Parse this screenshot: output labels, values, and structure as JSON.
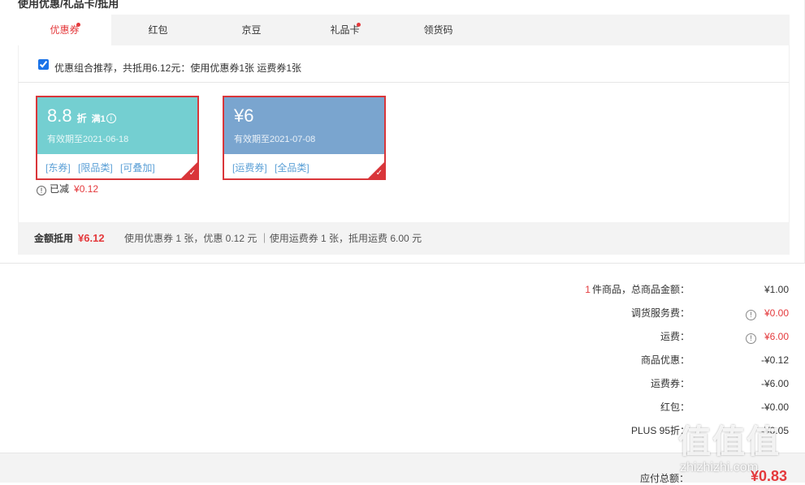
{
  "section_title": "使用优惠/礼品卡/抵用",
  "tabs": [
    {
      "label": "优惠券",
      "dot": true
    },
    {
      "label": "红包",
      "dot": false
    },
    {
      "label": "京豆",
      "dot": false
    },
    {
      "label": "礼品卡",
      "dot": true
    },
    {
      "label": "领货码",
      "dot": false
    }
  ],
  "recommend": {
    "checked": true,
    "text": "优惠组合推荐，共抵用6.12元：使用优惠券1张 运费券1张"
  },
  "coupons": [
    {
      "value": "8.8",
      "unit": "折",
      "condition": "满1",
      "expiry": "有效期至2021-06-18",
      "tags": [
        "[东券]",
        "[限品类]",
        "[可叠加]"
      ],
      "color": "#74cfd1"
    },
    {
      "value": "¥6",
      "expiry": "有效期至2021-07-08",
      "tags": [
        "[运费券]",
        "[全品类]"
      ],
      "color": "#7aa5cf"
    }
  ],
  "saved": {
    "label": "已减",
    "amount": "¥0.12"
  },
  "summary": {
    "label": "金额抵用",
    "amount": "¥6.12",
    "desc": "使用优惠券 1 张，优惠 0.12 元 ｜使用运费券 1 张，抵用运费 6.00 元"
  },
  "totals": [
    {
      "count": "1",
      "label": "件商品，总商品金额：",
      "value": "¥1.00",
      "red": false,
      "info": false
    },
    {
      "label": "调货服务费：",
      "value": "¥0.00",
      "red": true,
      "info": true
    },
    {
      "label": "运费：",
      "value": "¥6.00",
      "red": true,
      "info": true
    },
    {
      "label": "商品优惠：",
      "value": "-¥0.12",
      "red": false,
      "info": false
    },
    {
      "label": "运费券：",
      "value": "-¥6.00",
      "red": false,
      "info": false
    },
    {
      "label": "红包：",
      "value": "-¥0.00",
      "red": false,
      "info": false
    },
    {
      "label": "PLUS 95折：",
      "value": "-¥0.05",
      "red": false,
      "info": false
    }
  ],
  "grand_total": {
    "label": "应付总额：",
    "value": "¥0.83"
  },
  "watermark": {
    "logo": "值值值",
    "url": "zhizhizhi.com"
  },
  "colors": {
    "accent": "#e4393c",
    "coupon_border": "#d9363a",
    "tag_blue": "#5a9fd6"
  }
}
